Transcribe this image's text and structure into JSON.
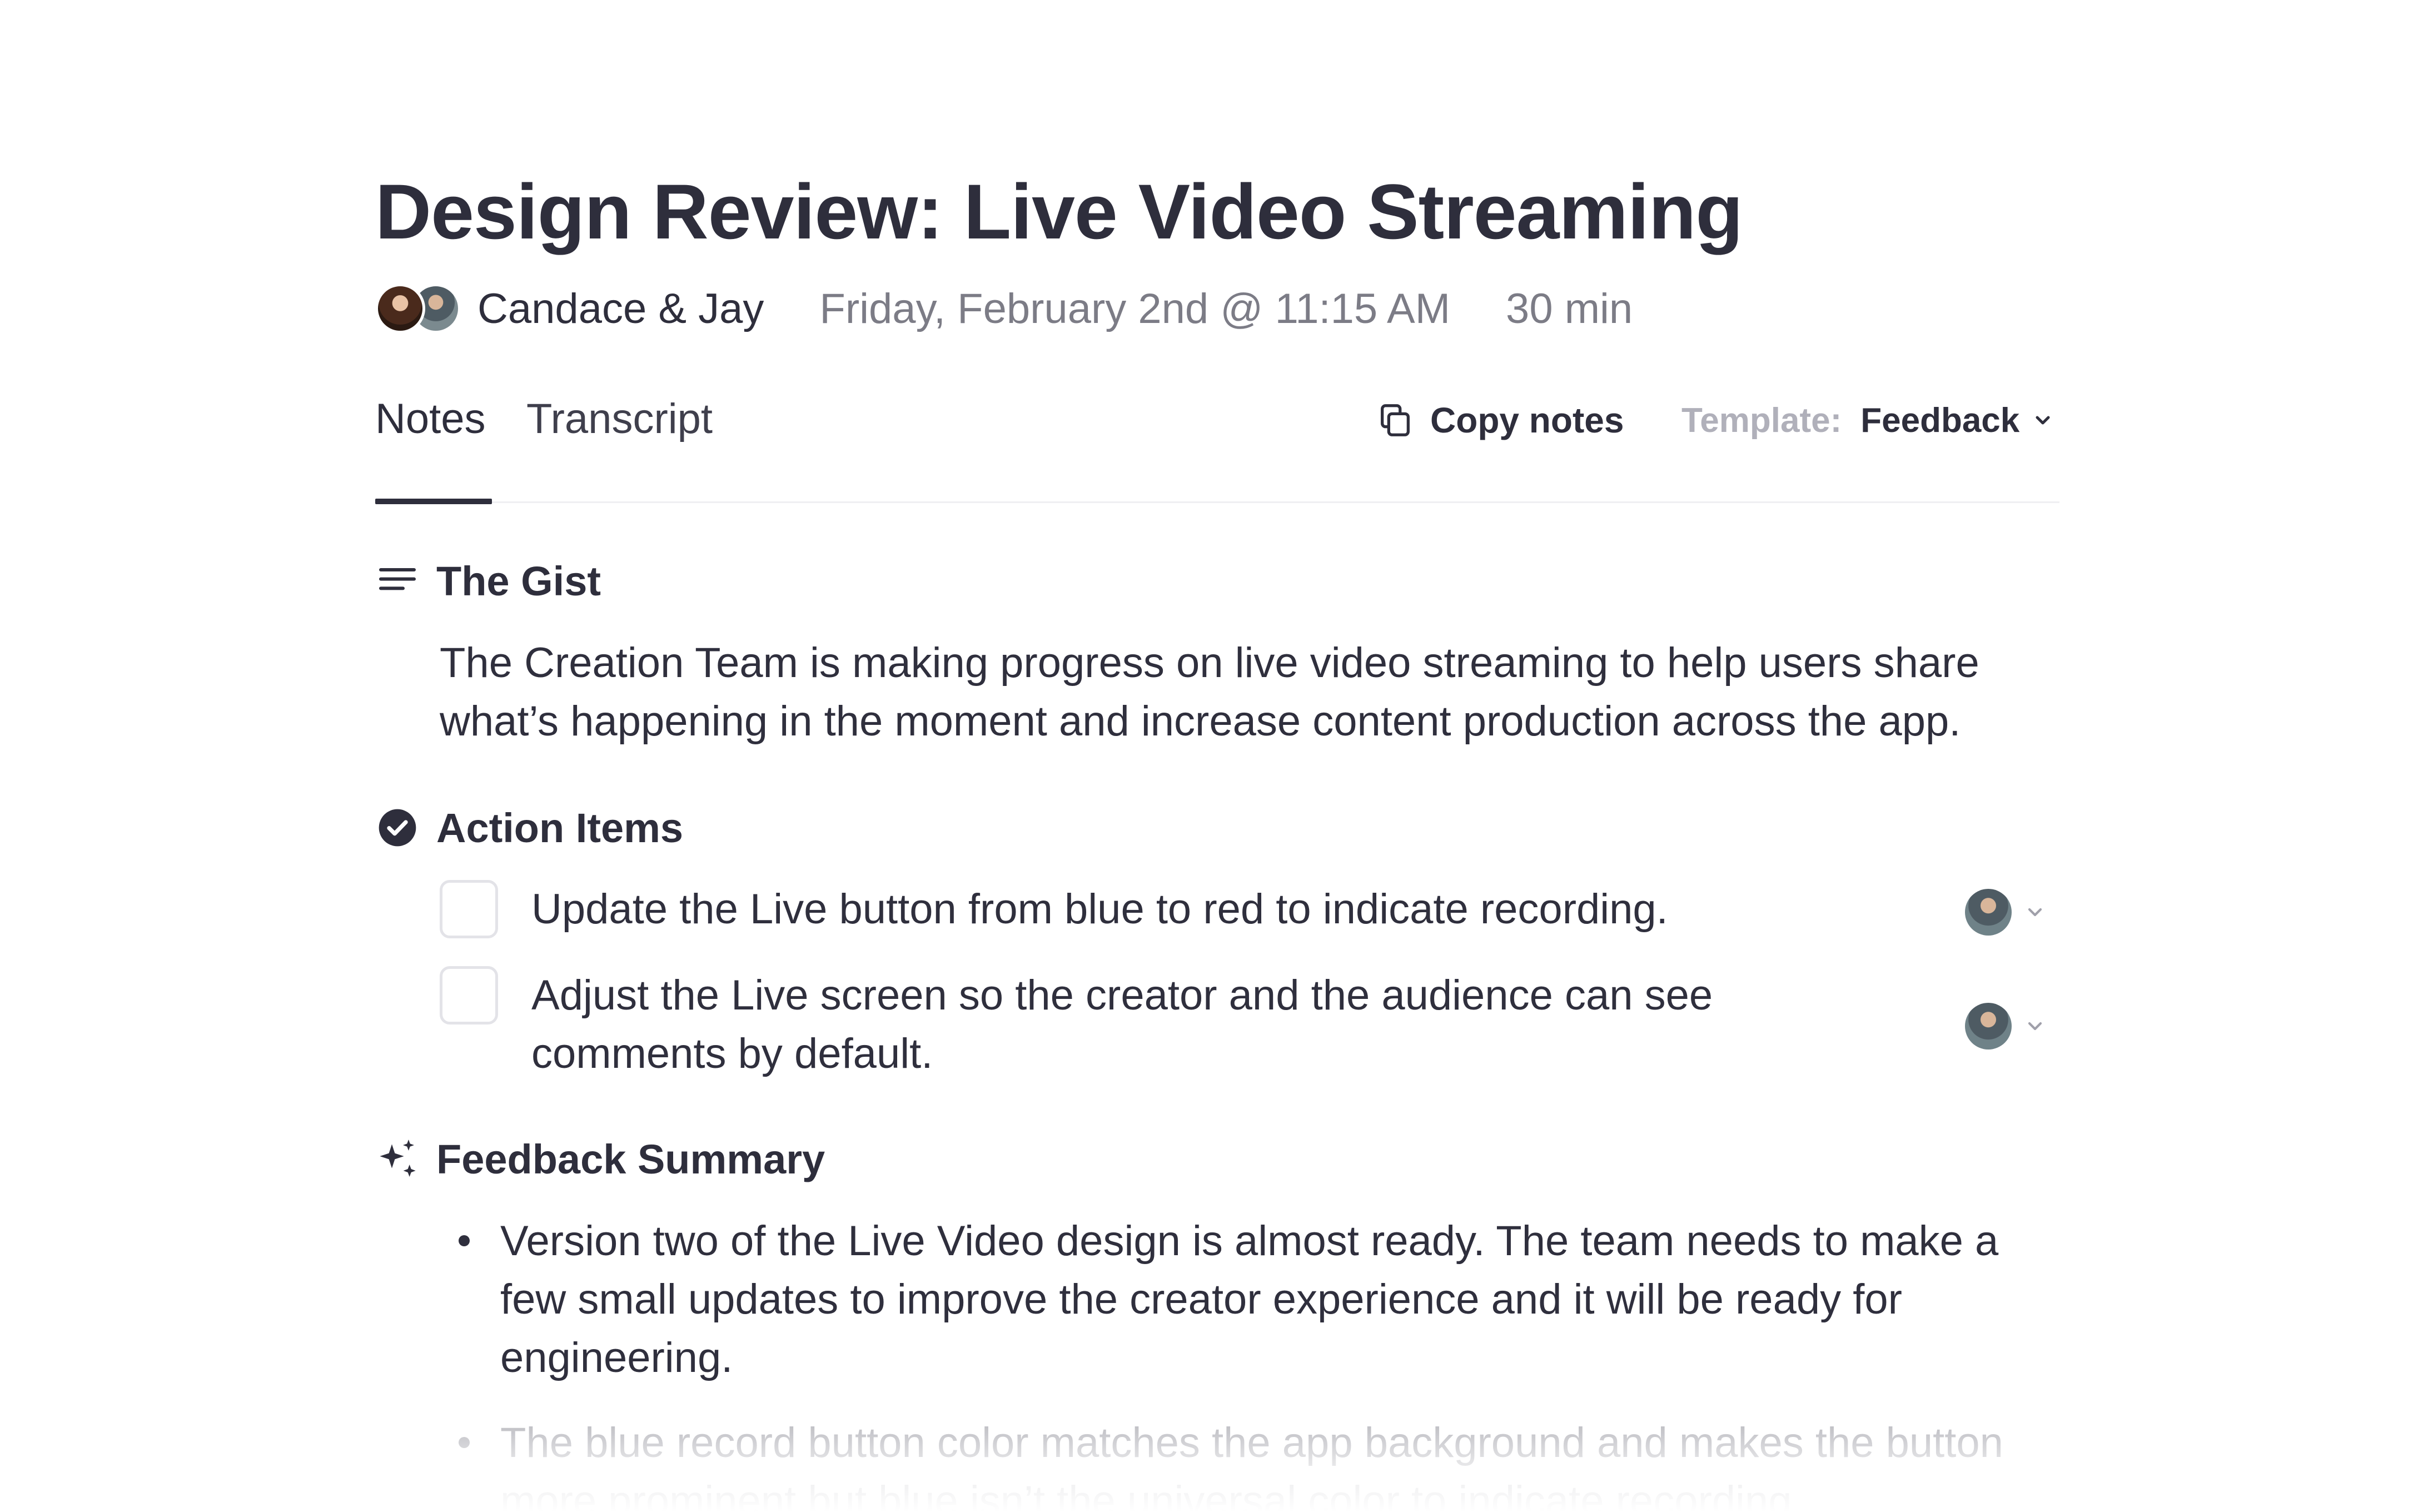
{
  "meeting": {
    "title": "Design Review: Live Video Streaming",
    "participants": "Candace & Jay",
    "date": "Friday, February 2nd @ 11:15 AM",
    "duration": "30 min"
  },
  "tabs": [
    {
      "label": "Notes",
      "active": true
    },
    {
      "label": "Transcript",
      "active": false
    }
  ],
  "toolbar": {
    "copy_label": "Copy notes",
    "template_label": "Template:",
    "template_value": "Feedback"
  },
  "sections": {
    "gist": {
      "title": "The Gist",
      "icon": "lines-icon",
      "text": "The Creation Team is making progress on live video streaming to help users share what’s happening in the moment and increase content production across the app."
    },
    "actions": {
      "title": "Action Items",
      "icon": "check-circle-icon",
      "items": [
        {
          "text": "Update the Live button from blue to red to indicate recording.",
          "checked": false
        },
        {
          "text": "Adjust the Live screen so the creator and the audience can see comments by default.",
          "checked": false
        }
      ]
    },
    "feedback": {
      "title": "Feedback Summary",
      "icon": "sparkles-icon",
      "bullets": [
        "Version two of the Live Video design is almost ready. The team needs to make a few small updates to improve the creator experience and it will be ready for engineering.",
        "The blue record button color matches the app background and makes the button more prominent but blue isn’t the universal color to indicate recording."
      ]
    }
  },
  "colors": {
    "text": "#2e2e3c",
    "muted": "#7c7c86",
    "faint": "#b0b0ba",
    "border": "#e3e3e8"
  }
}
